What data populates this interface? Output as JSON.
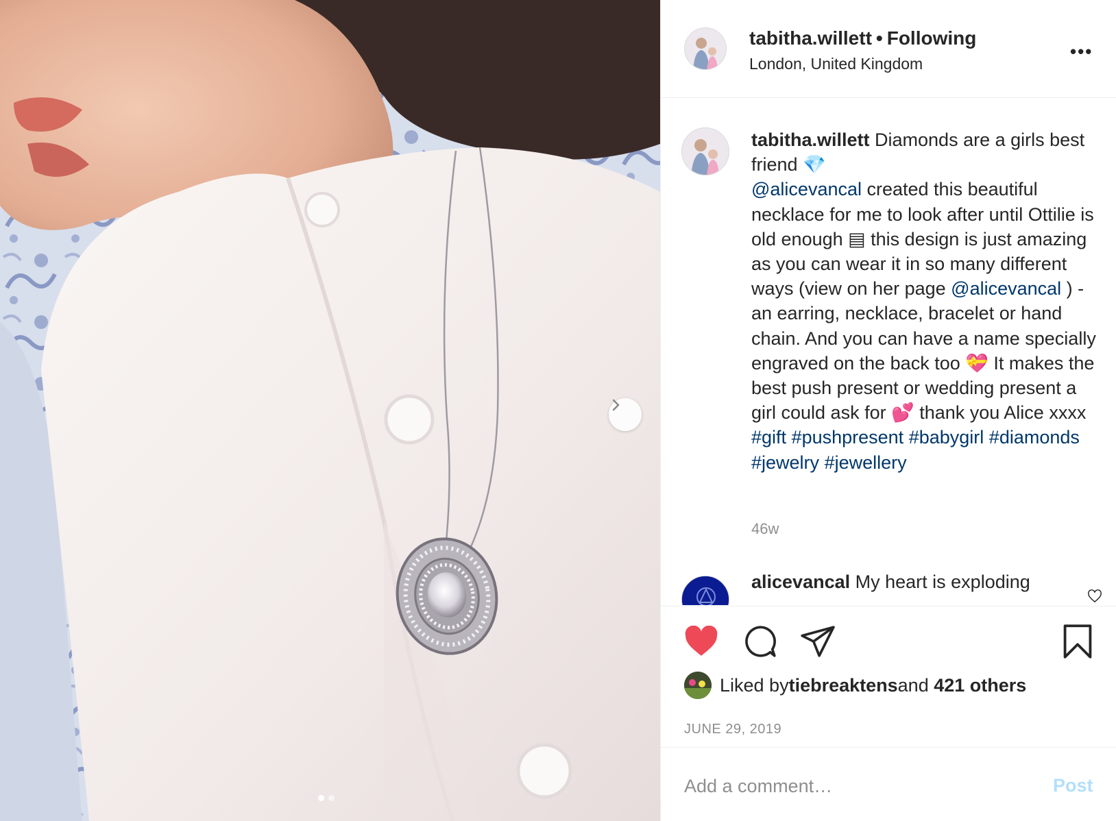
{
  "post": {
    "username": "tabitha.willett",
    "bullet": "•",
    "follow_label": "Following",
    "location": "London, United Kingdom",
    "more_icon": "more-options-icon",
    "more_label": "•••"
  },
  "caption": {
    "username": "tabitha.willett",
    "part1": " Diamonds are a girls best friend 💎",
    "mention1": "@alicevancal",
    "part2": " created this beautiful necklace for me to look after until Ottilie is old enough ",
    "emoji_box": "▤",
    "part3": " this design is just amazing as you can wear it in so many different ways (view on her page ",
    "mention2": "@alicevancal",
    "part4": " ) - an earring, necklace, bracelet or hand chain. And you can have a name specially engraved on the back too 💝 It makes the best push present or wedding present a girl could ask for 💕 thank you Alice xxxx",
    "hashtags": [
      "#gift",
      "#pushpresent",
      "#babygirl",
      "#diamonds",
      "#jewelry",
      "#jewellery"
    ],
    "time_ago": "46w"
  },
  "reply": {
    "username": "alicevancal",
    "text": " My heart is exploding"
  },
  "actions": {
    "like_icon": "heart-filled-icon",
    "comment_icon": "comment-icon",
    "share_icon": "share-icon",
    "save_icon": "bookmark-icon",
    "like_color": "#ed4956"
  },
  "likes": {
    "prefix": "Liked by ",
    "user": "tiebreaktens",
    "middle": " and ",
    "others": "421 others"
  },
  "date": "JUNE 29, 2019",
  "comment_box": {
    "placeholder": "Add a comment…",
    "post_label": "Post"
  },
  "carousel": {
    "slide_count": 2,
    "active_index": 0
  }
}
